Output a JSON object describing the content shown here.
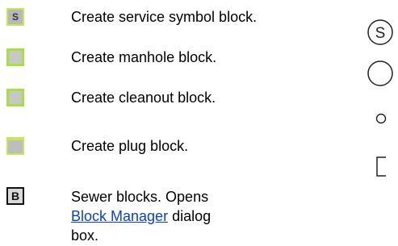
{
  "rows": [
    {
      "icon": "service-symbol-icon",
      "icon_letter": "S",
      "label": "Create service symbol block."
    },
    {
      "icon": "manhole-icon",
      "label": "Create manhole block."
    },
    {
      "icon": "cleanout-icon",
      "label": "Create cleanout block."
    },
    {
      "icon": "plug-icon",
      "label": "Create plug block."
    },
    {
      "icon": "block-icon",
      "icon_letter": "B",
      "label_before": "Sewer blocks. Opens ",
      "link": "Block Manager",
      "label_after": " dialog box."
    }
  ],
  "symbols": {
    "service_letter": "S"
  },
  "colors": {
    "accent_green": "#a8e040",
    "icon_gray": "#c7c7c7",
    "link": "#0b40c8"
  }
}
